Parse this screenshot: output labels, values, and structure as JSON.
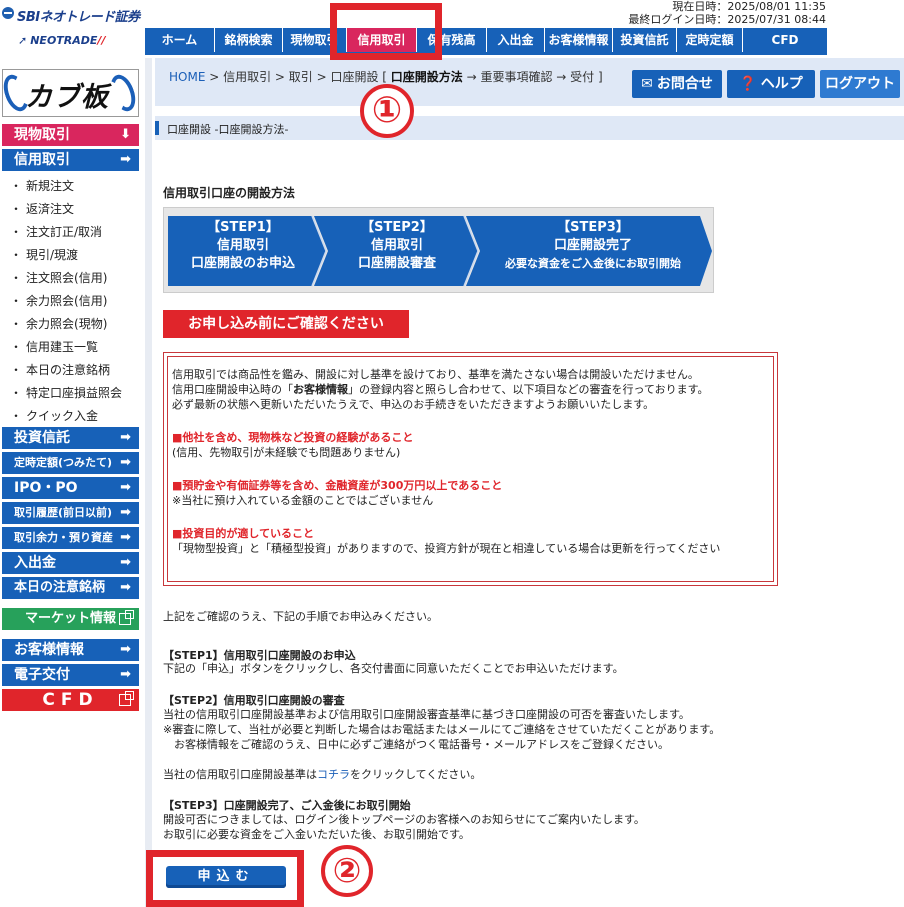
{
  "header": {
    "brand": "SBIネオトレード証券",
    "sub_brand": "NEOTRADE",
    "current_time_label": "現在日時：2025/08/01 11:35",
    "last_login_label": "最終ログイン日時：2025/07/31 08:44"
  },
  "topnav": [
    {
      "label": "ホーム"
    },
    {
      "label": "銘柄検索"
    },
    {
      "label": "現物取引"
    },
    {
      "label": "信用取引"
    },
    {
      "label": "保有残高"
    },
    {
      "label": "入出金"
    },
    {
      "label": "お客様情報"
    },
    {
      "label": "投資信託"
    },
    {
      "label": "定時定額"
    },
    {
      "label": "CFD"
    }
  ],
  "sidebar": {
    "kabuita_label": "カブ板",
    "items": [
      {
        "label": "現物取引",
        "arrow": "⬇"
      },
      {
        "label": "信用取引",
        "arrow": "➡"
      }
    ],
    "sub_items": [
      "新規注文",
      "返済注文",
      "注文訂正/取消",
      "現引/現渡",
      "注文照会(信用)",
      "余力照会(信用)",
      "余力照会(現物)",
      "信用建玉一覧",
      "本日の注意銘柄",
      "特定口座損益照会",
      "クイック入金"
    ],
    "lower_items": [
      {
        "label": "投資信託",
        "arrow": "➡"
      },
      {
        "label": "定時定額(つみたて)",
        "arrow": "➡"
      },
      {
        "label": "IPO・PO",
        "arrow": "➡"
      },
      {
        "label": "取引履歴(前日以前)",
        "arrow": "➡"
      },
      {
        "label": "取引余力・預り資産",
        "arrow": "➡"
      },
      {
        "label": "入出金",
        "arrow": "➡"
      },
      {
        "label": "本日の注意銘柄",
        "arrow": "➡"
      }
    ],
    "market_label": "マーケット情報",
    "customer_label": "お客様情報",
    "delivery_label": "電子交付",
    "cfd_label": "CFD"
  },
  "breadcrumb": {
    "home": "HOME",
    "path1": " > 信用取引 > 取引 > ",
    "path2": "口座開設 [ ",
    "bold": "口座開設方法",
    "path3": " → 重要事項確認 → 受付 ]"
  },
  "header_buttons": {
    "contact": "お問合せ",
    "help": "ヘルプ",
    "logout": "ログアウト"
  },
  "page_header": "口座開設 -口座開設方法-",
  "annotations": {
    "one": "①",
    "two": "②"
  },
  "section_title": "信用取引口座の開設方法",
  "steps": [
    {
      "title": "【STEP1】",
      "line1": "信用取引",
      "line2": "口座開設のお申込",
      "color": "#1761b8"
    },
    {
      "title": "【STEP2】",
      "line1": "信用取引",
      "line2": "口座開設審査",
      "color": "#1761b8"
    },
    {
      "title": "【STEP3】",
      "line1": "口座開設完了",
      "line2": "必要な資金をご入金後にお取引開始",
      "color": "#1761b8"
    }
  ],
  "confirm_label": "お申し込み前にご確認ください",
  "notice": {
    "intro1": "信用取引では商品性を鑑み、開設に対し基準を設けており、基準を満たさない場合は開設いただけません。",
    "intro2a": "信用口座開設申込時の「",
    "intro2b": "お客様情報",
    "intro2c": "」の登録内容と照らし合わせて、以下項目などの審査を行っております。",
    "intro3": "必ず最新の状態へ更新いただいたうえで、申込のお手続きをいただきますようお願いいたします。",
    "req1": "■他社を含め、現物株など投資の経験があること",
    "req1_note": "(信用、先物取引が未経験でも問題ありません)",
    "req2": "■預貯金や有価証券等を含め、金融資産が300万円以上であること",
    "req2_note": "※当社に預け入れている金額のことではございません",
    "req3": "■投資目的が適していること",
    "req3_note": "「現物型投資」と「積極型投資」がありますので、投資方針が現在と相違している場合は更新を行ってください"
  },
  "body": {
    "confirm_line": "上記をご確認のうえ、下記の手順でお申込みください。",
    "step1_head": "【STEP1】信用取引口座開設のお申込",
    "step1_text": "下記の「申込」ボタンをクリックし、各交付書面に同意いただくことでお申込いただけます。",
    "step2_head": "【STEP2】信用取引口座開設の審査",
    "step2_text1": "当社の信用取引口座開設基準および信用取引口座開設審査基準に基づき口座開設の可否を審査いたします。",
    "step2_text2": "※審査に際して、当社が必要と判断した場合はお電話またはメールにてご連絡をさせていただくことがあります。",
    "step2_text3": "　お客様情報をご確認のうえ、日中に必ずご連絡がつく電話番号・メールアドレスをご登録ください。",
    "criteria_a": "当社の信用取引口座開設基準は",
    "criteria_link": "コチラ",
    "criteria_b": "をクリックしてください。",
    "step3_head": "【STEP3】口座開設完了、ご入金後にお取引開始",
    "step3_text1": "開設可否につきましては、ログイン後トップページのお客様へのお知らせにてご案内いたします。",
    "step3_text2": "お取引に必要な資金をご入金いただいた後、お取引開始です。",
    "apply_label": "申込む"
  }
}
